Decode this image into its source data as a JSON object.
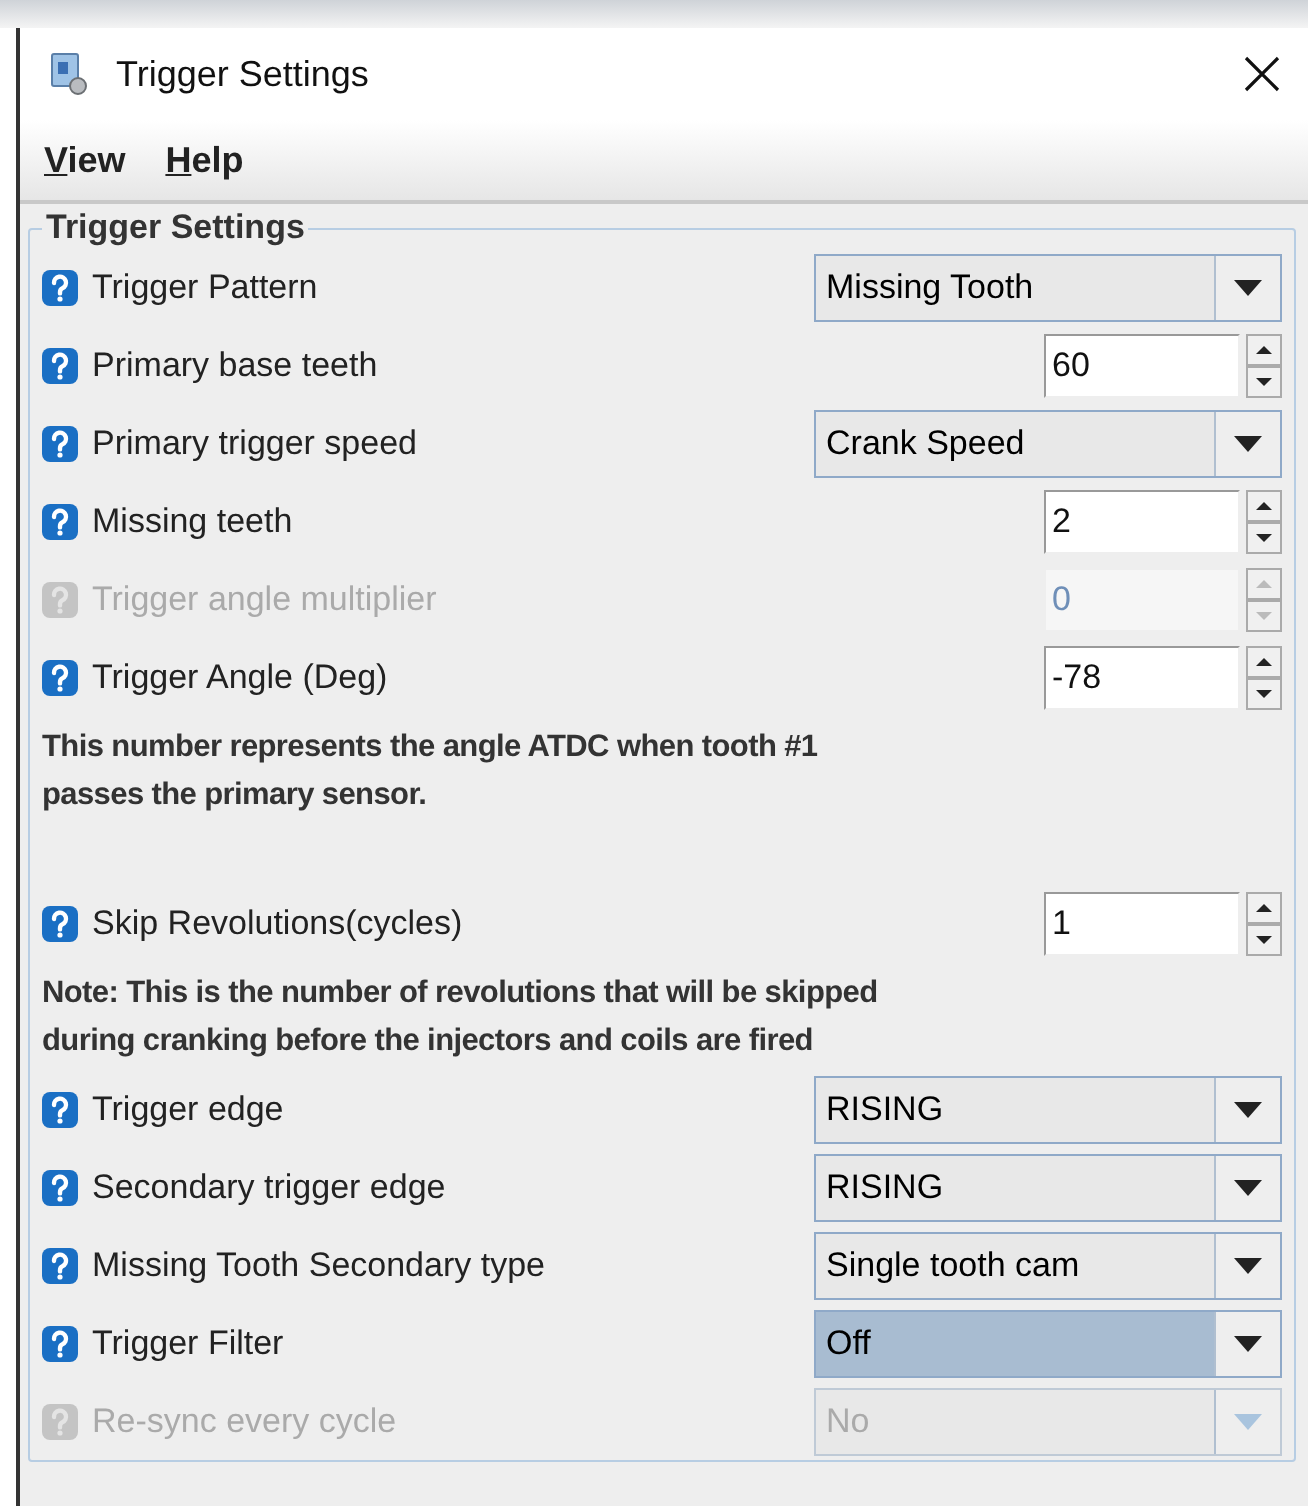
{
  "window": {
    "title": "Trigger Settings"
  },
  "menu": [
    {
      "label": "View"
    },
    {
      "label": "Help"
    }
  ],
  "group": {
    "title": "Trigger Settings"
  },
  "rows": [
    {
      "kind": "combo",
      "label": "Trigger Pattern",
      "value": "Missing Tooth",
      "disabled": false,
      "focused": false
    },
    {
      "kind": "spinner",
      "label": "Primary base teeth",
      "value": "60",
      "disabled": false
    },
    {
      "kind": "combo",
      "label": "Primary trigger speed",
      "value": "Crank Speed",
      "disabled": false,
      "focused": false
    },
    {
      "kind": "spinner",
      "label": "Missing teeth",
      "value": "2",
      "disabled": false
    },
    {
      "kind": "spinner",
      "label": "Trigger angle multiplier",
      "value": "0",
      "disabled": true
    },
    {
      "kind": "spinner",
      "label": "Trigger Angle (Deg)",
      "value": "-78",
      "disabled": false
    },
    {
      "kind": "note",
      "text": "This number represents the angle ATDC when tooth #1 passes the primary sensor."
    },
    {
      "kind": "spacer"
    },
    {
      "kind": "spinner",
      "label": "Skip Revolutions(cycles)",
      "value": "1",
      "disabled": false
    },
    {
      "kind": "note",
      "text": "Note: This is the number of revolutions that will be skipped during cranking before the injectors and coils are fired"
    },
    {
      "kind": "combo",
      "label": "Trigger edge",
      "value": "RISING",
      "disabled": false,
      "focused": false
    },
    {
      "kind": "combo",
      "label": "Secondary trigger edge",
      "value": "RISING",
      "disabled": false,
      "focused": false
    },
    {
      "kind": "combo",
      "label": "Missing Tooth Secondary type",
      "value": "Single tooth cam",
      "disabled": false,
      "focused": false
    },
    {
      "kind": "combo",
      "label": "Trigger Filter",
      "value": "Off",
      "disabled": false,
      "focused": true
    },
    {
      "kind": "combo",
      "label": "Re-sync every cycle",
      "value": "No",
      "disabled": true,
      "focused": false
    }
  ]
}
